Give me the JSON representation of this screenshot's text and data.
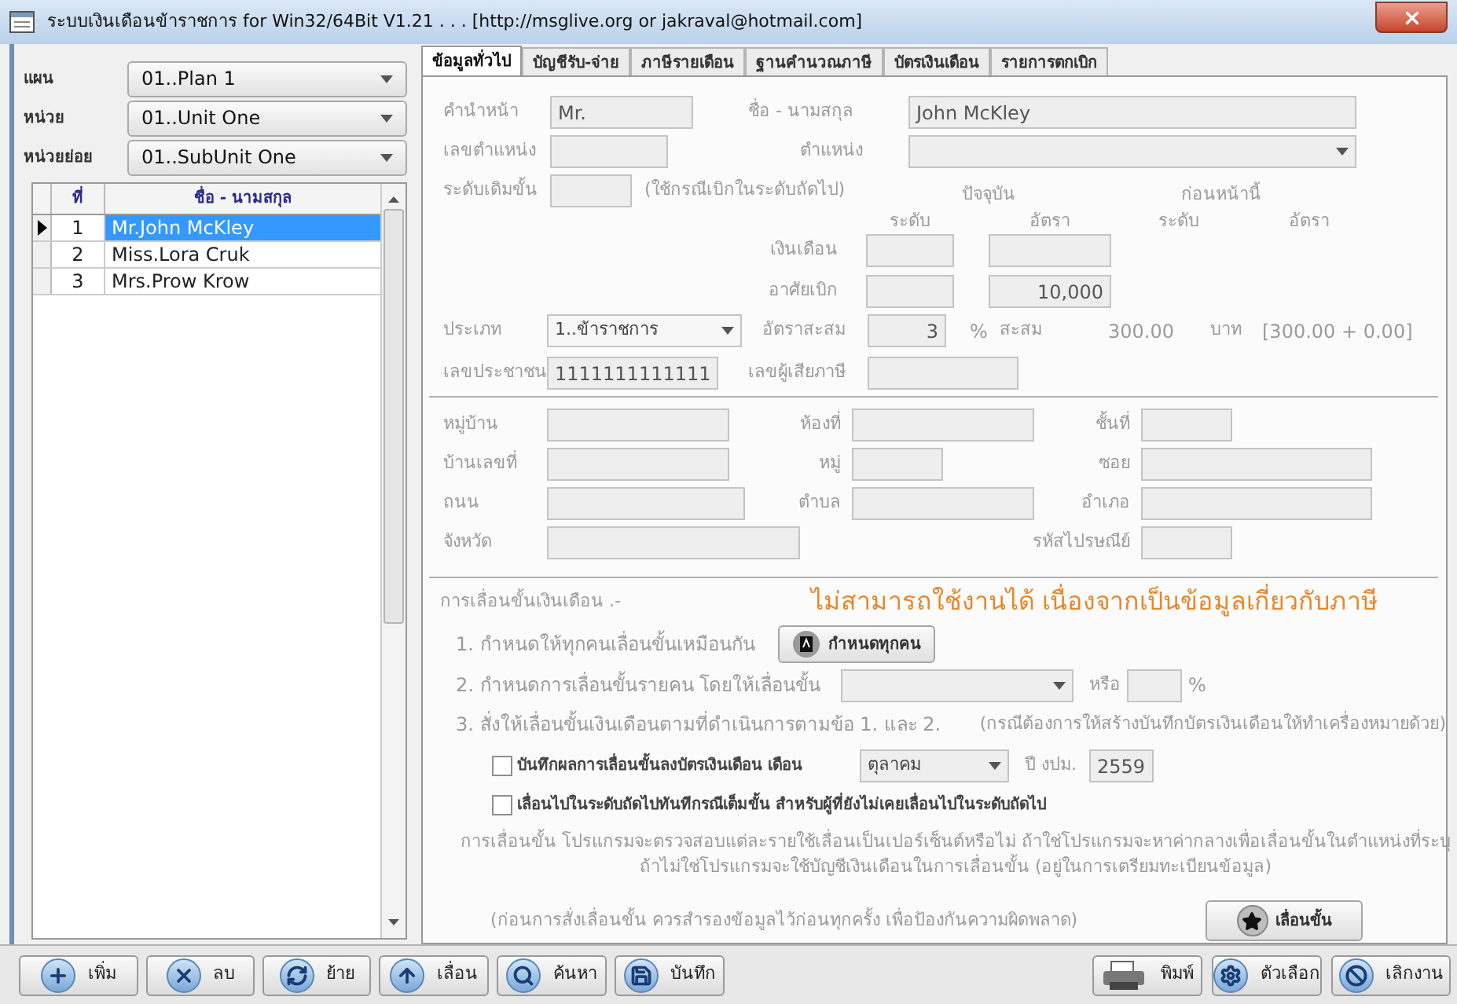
{
  "window": {
    "title": "ระบบเงินเดือนข้าราชการ for Win32/64Bit V1.21 . . . [http://msglive.org or jakraval@hotmail.com]"
  },
  "filters": [
    {
      "label": "แผน",
      "value": "01..Plan 1"
    },
    {
      "label": "หน่วย",
      "value": "01..Unit One"
    },
    {
      "label": "หน่วยย่อย",
      "value": "01..SubUnit One"
    }
  ],
  "table": {
    "columns": [
      "ที่",
      "ชื่อ - นามสกุล"
    ],
    "rows": [
      {
        "no": "1",
        "name": "Mr.John McKley",
        "selected": true
      },
      {
        "no": "2",
        "name": "Miss.Lora Cruk",
        "selected": false
      },
      {
        "no": "3",
        "name": "Mrs.Prow Krow",
        "selected": false
      }
    ]
  },
  "tabs": [
    {
      "label": "ข้อมูลทั่วไป",
      "selected": true
    },
    {
      "label": "บัญชีรับ-จ่าย",
      "selected": false
    },
    {
      "label": "ภาษีรายเดือน",
      "selected": false
    },
    {
      "label": "ฐานคำนวณภาษี",
      "selected": false
    },
    {
      "label": "บัตรเงินเดือน",
      "selected": false
    },
    {
      "label": "รายการตกเบิก",
      "selected": false
    }
  ],
  "general": {
    "prefix": {
      "label": "คำนำหน้า",
      "value": "Mr."
    },
    "full_name": {
      "label": "ชื่อ - นามสกุล",
      "value": "John McKley"
    },
    "position_no": {
      "label": "เลขตำแหน่ง"
    },
    "position": {
      "label": "ตำแหน่ง"
    },
    "original_grade": {
      "label": "ระดับเดิมขั้น",
      "note": "(ใช้กรณีเบิกในระดับถัดไป)"
    },
    "group_headers": [
      "ปัจจุบัน",
      "ก่อนหน้านี้"
    ],
    "column_headers": [
      "ระดับ",
      "อัตรา",
      "ระดับ",
      "อัตรา"
    ],
    "salary_rows": [
      {
        "label": "เงินเดือน"
      },
      {
        "label": "อาศัยเบิก",
        "rate": "10,000"
      }
    ],
    "type": {
      "label": "ประเภท",
      "value": "1..ข้าราชการ"
    },
    "accum_rate": {
      "label": "อัตราสะสม",
      "value": "3",
      "unit": "%"
    },
    "accum": {
      "label": "สะสม",
      "amount": "300.00",
      "currency": "บาท",
      "breakdown": "[300.00 + 0.00]"
    },
    "citizen_id": {
      "label": "เลขประชาชน",
      "value": "1111111111111"
    },
    "tax_id": {
      "label": "เลขผู้เสียภาษี"
    }
  },
  "address": [
    [
      {
        "label": "หมู่บ้าน"
      },
      {
        "label": "ห้องที่"
      },
      {
        "label": "ชั้นที่"
      }
    ],
    [
      {
        "label": "บ้านเลขที่"
      },
      {
        "label": "หมู่"
      },
      {
        "label": "ซอย"
      }
    ],
    [
      {
        "label": "ถนน"
      },
      {
        "label": "ตำบล"
      },
      {
        "label": "อำเภอ"
      }
    ],
    [
      {
        "label": "จังหวัด"
      },
      {
        "label": "รหัสไปรษณีย์"
      }
    ]
  ],
  "raise": {
    "title": "การเลื่อนขั้นเงินเดือน .-",
    "warning": "ไม่สามารถใช้งานได้ เนื่องจากเป็นข้อมูลเกี่ยวกับภาษี",
    "step1": {
      "text": "1. กำหนดให้ทุกคนเลื่อนขั้นเหมือนกัน",
      "button": "กำหนดทุกคน"
    },
    "step2": {
      "text": "2. กำหนดการเลื่อนขั้นรายคน โดยให้เลื่อนขั้น",
      "or": "หรือ",
      "unit": "%"
    },
    "step3": {
      "text": "3. สั่งให้เลื่อนขั้นเงินเดือนตามที่ดำเนินการตามข้อ 1. และ 2.",
      "note": "(กรณีต้องการให้สร้างบันทึกบัตรเงินเดือนให้ทำเครื่องหมายด้วย)"
    },
    "save_to_card": {
      "label": "บันทึกผลการเลื่อนขั้นลงบัตรเงินเดือน เดือน",
      "checked": false,
      "month": "ตุลาคม",
      "year_label": "ปี งปม.",
      "year": "2559"
    },
    "next_level": {
      "label": "เลื่อนไปในระดับถัดไปทันทีกรณีเต็มขั้น สำหรับผู้ที่ยังไม่เคยเลื่อนไปในระดับถัดไป",
      "checked": false
    },
    "explanation": [
      "การเลื่อนขั้น โปรแกรมจะตรวจสอบแต่ละรายใช้เลื่อนเป็นเปอร์เซ็นต์หรือไม่  ถ้าใช่โปรแกรมจะหาค่ากลางเพื่อเลื่อนขั้นในตำแหน่งที่ระบุ",
      "ถ้าไม่ใช่โปรแกรมจะใช้บัญชีเงินเดือนในการเลื่อนขั้น (อยู่ในการเตรียมทะเบียนข้อมูล)"
    ],
    "backup_note": "(ก่อนการสั่งเลื่อนขั้น ควรสำรองข้อมูลไว้ก่อนทุกครั้ง เพื่อป้องกันความผิดพลาด)",
    "raise_button": "เลื่อนขั้น"
  },
  "toolbar": {
    "left": [
      {
        "label": "เพิ่ม",
        "kind": "add"
      },
      {
        "label": "ลบ",
        "kind": "delete"
      },
      {
        "label": "ย้าย",
        "kind": "move"
      },
      {
        "label": "เลื่อน",
        "kind": "promote"
      },
      {
        "label": "ค้นหา",
        "kind": "search"
      },
      {
        "label": "บันทึก",
        "kind": "save"
      }
    ],
    "right": [
      {
        "label": "พิมพ์",
        "kind": "print"
      },
      {
        "label": "ตัวเลือก",
        "kind": "options"
      },
      {
        "label": "เลิกงาน",
        "kind": "exit"
      }
    ]
  }
}
